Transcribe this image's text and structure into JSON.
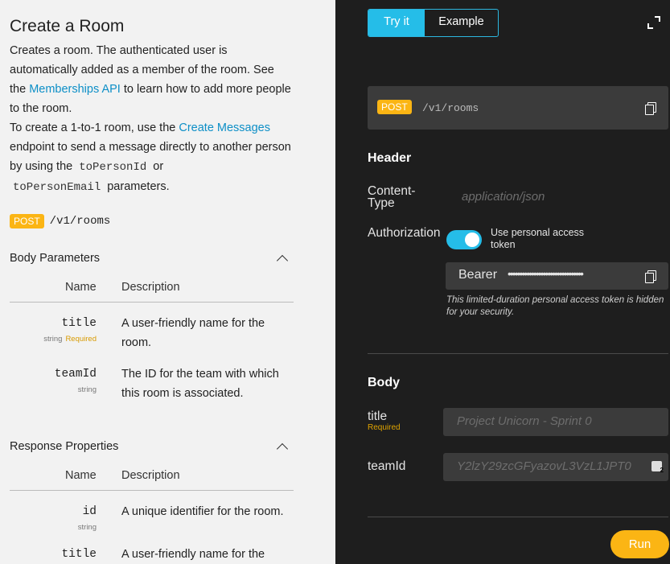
{
  "docs": {
    "title": "Create a Room",
    "description": {
      "p1_before_link": "Creates a room. The authenticated user is automatically added as a member of the room. See the ",
      "p1_link": "Memberships API",
      "p1_after_link": " to learn how to add more people to the room.",
      "p2_before_link": "To create a 1-to-1 room, use the ",
      "p2_link": "Create Messages",
      "p2_mid": " endpoint to send a message directly to another person by using the ",
      "p2_code1": "toPersonId",
      "p2_or": " or ",
      "p2_code2": "toPersonEmail",
      "p2_end": " parameters."
    },
    "method": "POST",
    "path": "/v1/rooms",
    "body_parameters": {
      "heading": "Body Parameters",
      "col_name": "Name",
      "col_description": "Description",
      "items": [
        {
          "name": "title",
          "type": "string",
          "required": "Required",
          "description": "A user-friendly name for the room."
        },
        {
          "name": "teamId",
          "type": "string",
          "required": "",
          "description": "The ID for the team with which this room is associated."
        }
      ]
    },
    "response_properties": {
      "heading": "Response Properties",
      "col_name": "Name",
      "col_description": "Description",
      "items": [
        {
          "name": "id",
          "type": "string",
          "description": "A unique identifier for the room."
        },
        {
          "name": "title",
          "type": "",
          "description": "A user-friendly name for the"
        }
      ]
    }
  },
  "try_it": {
    "tabs": [
      {
        "label": "Try it"
      },
      {
        "label": "Example"
      }
    ],
    "method": "POST",
    "path": "/v1/rooms",
    "header": {
      "heading": "Header",
      "content_type_label": "Content-Type",
      "content_type_placeholder": "application/json",
      "authorization_label": "Authorization",
      "toggle_label": "Use personal access token",
      "toggle_on": true,
      "bearer_label": "Bearer",
      "token_mask": "••••••••••••••••••••••••••••••••",
      "token_hint": "This limited-duration personal access token is hidden for your security."
    },
    "body": {
      "heading": "Body",
      "title_label": "title",
      "title_required": "Required",
      "title_placeholder": "Project Unicorn - Sprint 0",
      "teamid_label": "teamId",
      "teamid_placeholder": "Y2lzY29zcGFyazovL3VzL1JPT0"
    },
    "run_label": "Run"
  },
  "colors": {
    "accent": "#25bde8",
    "link": "#0d8fc7",
    "post_badge": "#fbb514",
    "run_button": "#fbb514"
  },
  "icons": [
    "collapse-chevron-icon",
    "expand-icon",
    "copy-icon",
    "keyboard-icon"
  ]
}
